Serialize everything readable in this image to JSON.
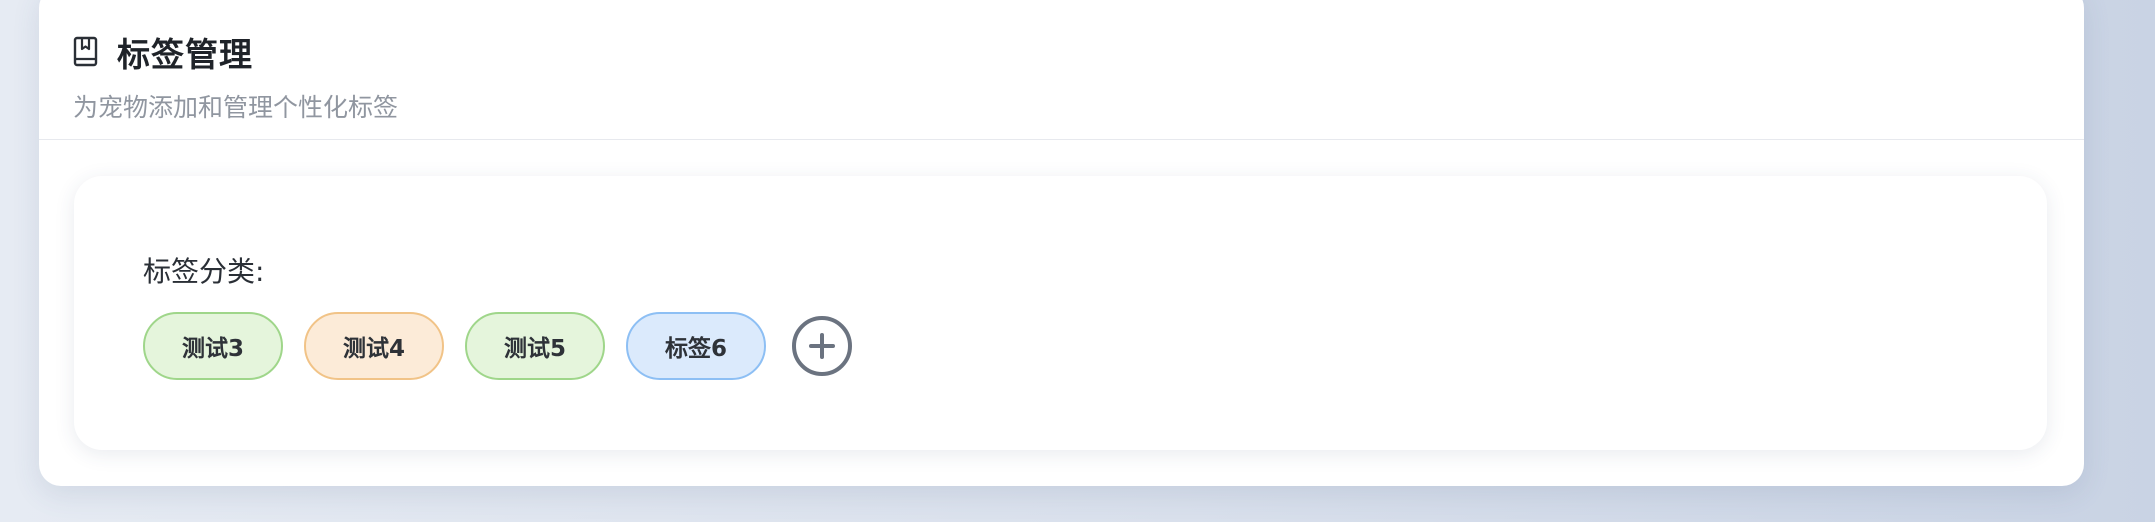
{
  "header": {
    "icon": "book-icon",
    "title": "标签管理",
    "subtitle": "为宠物添加和管理个性化标签"
  },
  "tag_section": {
    "label": "标签分类:",
    "tags": [
      {
        "label": "测试3",
        "color": "#e5f5dc",
        "border": "#9fd68a"
      },
      {
        "label": "测试4",
        "color": "#fcebd8",
        "border": "#f1c387"
      },
      {
        "label": "测试5",
        "color": "#e5f5dc",
        "border": "#9fd68a"
      },
      {
        "label": "标签6",
        "color": "#dbeafc",
        "border": "#8dbff4"
      }
    ],
    "add_icon": "plus-circle-icon"
  },
  "colors": {
    "title": "#1f2329",
    "subtitle": "#9096a0",
    "add_button": "#6b7380"
  }
}
